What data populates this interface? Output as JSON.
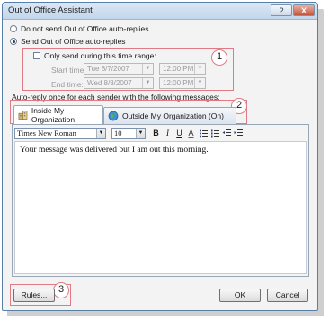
{
  "window": {
    "title": "Out of Office Assistant",
    "help_glyph": "?",
    "close_glyph": "X"
  },
  "options": {
    "do_not_send": "Do not send Out of Office auto-replies",
    "send": "Send Out of Office auto-replies",
    "selected": "send"
  },
  "time_range": {
    "checkbox_label": "Only send during this time range:",
    "checked": false,
    "start_label": "Start time:",
    "start_date": "Tue 8/7/2007",
    "start_time": "12:00 PM",
    "end_label": "End time:",
    "end_date": "Wed 8/8/2007",
    "end_time": "12:00 PM"
  },
  "section_label": "Auto-reply once for each sender with the following messages:",
  "tabs": [
    {
      "label": "Inside My Organization",
      "active": true
    },
    {
      "label": "Outside My Organization (On)",
      "active": false
    }
  ],
  "toolbar": {
    "font": "Times New Roman",
    "size": "10",
    "bold": "B",
    "italic": "I",
    "underline": "U",
    "font_color": "A"
  },
  "message": "Your message was delivered but I am out this morning.",
  "buttons": {
    "rules": "Rules...",
    "ok": "OK",
    "cancel": "Cancel"
  },
  "callouts": [
    "1",
    "2",
    "3"
  ],
  "colors": {
    "callout": "#e07a85",
    "titlebar": "#c2d6eb"
  }
}
